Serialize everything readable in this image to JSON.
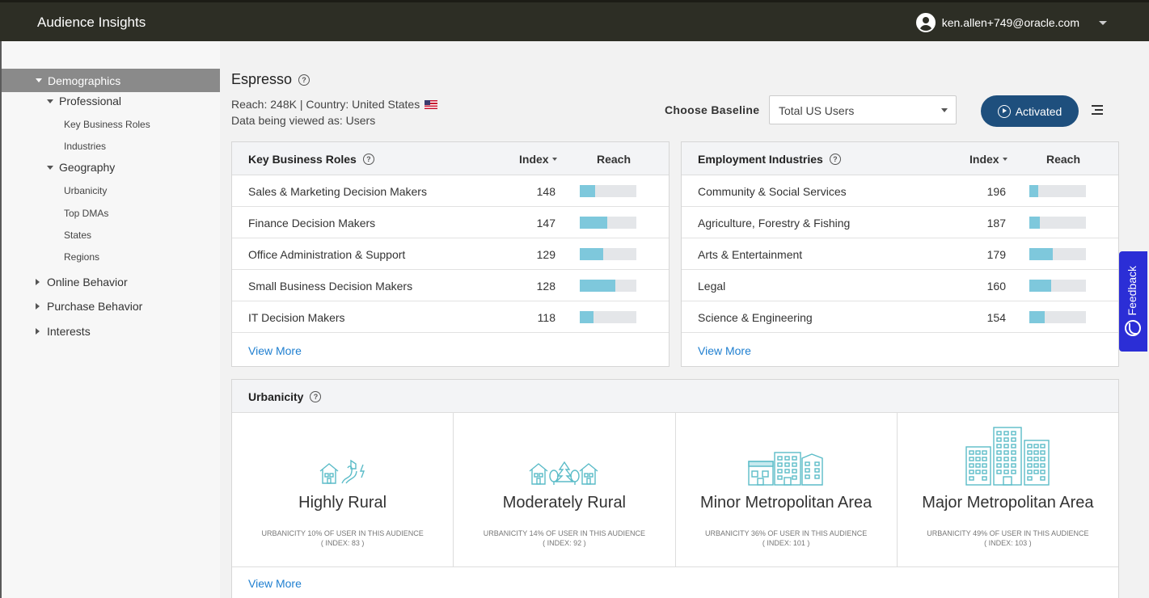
{
  "header": {
    "app_title": "Audience Insights",
    "user_email": "ken.allen+749@oracle.com"
  },
  "sidebar": {
    "demographics": "Demographics",
    "professional": "Professional",
    "key_business_roles": "Key Business Roles",
    "industries": "Industries",
    "geography": "Geography",
    "urbanicity": "Urbanicity",
    "top_dmas": "Top DMAs",
    "states": "States",
    "regions": "Regions",
    "online_behavior": "Online Behavior",
    "purchase_behavior": "Purchase Behavior",
    "interests": "Interests"
  },
  "audience": {
    "name": "Espresso",
    "reach_line": "Reach: 248K | Country: United States",
    "viewed_as": "Data being viewed as: Users"
  },
  "baseline": {
    "label": "Choose Baseline",
    "value": "Total US Users"
  },
  "activated_label": "Activated",
  "key_business_roles": {
    "title": "Key Business Roles",
    "col_index": "Index",
    "col_reach": "Reach",
    "rows": [
      {
        "label": "Sales & Marketing Decision Makers",
        "index": "148",
        "reach": 0.27
      },
      {
        "label": "Finance Decision Makers",
        "index": "147",
        "reach": 0.49
      },
      {
        "label": "Office Administration & Support",
        "index": "129",
        "reach": 0.42
      },
      {
        "label": "Small Business Decision Makers",
        "index": "128",
        "reach": 0.63
      },
      {
        "label": "IT Decision Makers",
        "index": "118",
        "reach": 0.24
      }
    ],
    "view_more": "View More"
  },
  "employment_industries": {
    "title": "Employment Industries",
    "col_index": "Index",
    "col_reach": "Reach",
    "rows": [
      {
        "label": "Community & Social Services",
        "index": "196",
        "reach": 0.16
      },
      {
        "label": "Agriculture, Forestry & Fishing",
        "index": "187",
        "reach": 0.18
      },
      {
        "label": "Arts & Entertainment",
        "index": "179",
        "reach": 0.41
      },
      {
        "label": "Legal",
        "index": "160",
        "reach": 0.38
      },
      {
        "label": "Science & Engineering",
        "index": "154",
        "reach": 0.27
      }
    ],
    "view_more": "View More"
  },
  "urbanicity": {
    "title": "Urbanicity",
    "cells": [
      {
        "name": "Highly Rural",
        "desc": "URBANICITY 10% OF USER IN THIS AUDIENCE",
        "index": "( INDEX: 83 )"
      },
      {
        "name": "Moderately Rural",
        "desc": "URBANICITY 14% OF USER IN THIS AUDIENCE",
        "index": "( INDEX: 92 )"
      },
      {
        "name": "Minor Metropolitan Area",
        "desc": "URBANICITY 36% OF USER IN THIS AUDIENCE",
        "index": "( INDEX: 101 )"
      },
      {
        "name": "Major Metropolitan Area",
        "desc": "URBANICITY 49% OF USER IN THIS AUDIENCE",
        "index": "( INDEX: 103 )"
      }
    ],
    "view_more": "View More"
  },
  "feedback_label": "Feedback",
  "colors": {
    "topbar": "#2d2e25",
    "accent_button": "#1e4f7d",
    "bar_fill": "#7ec8dc",
    "link": "#1f7fd0",
    "feedback": "#2b2ed6",
    "icon_teal": "#5bbcc8"
  }
}
